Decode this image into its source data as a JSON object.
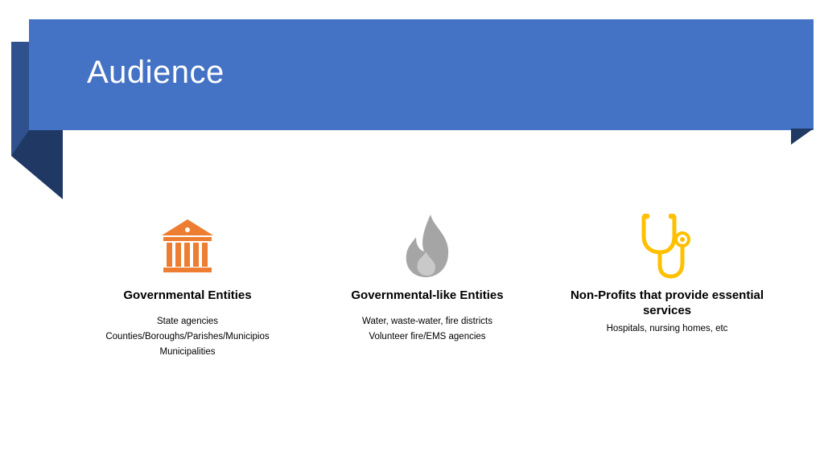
{
  "slide": {
    "title": "Audience"
  },
  "colors": {
    "banner": "#4472c4",
    "fold": "#2f528f",
    "government_icon": "#ed7d31",
    "flame_icon": "#a5a5a5",
    "stethoscope_icon": "#ffc000"
  },
  "columns": [
    {
      "icon": "government-building-icon",
      "heading": "Governmental Entities",
      "lines": [
        "State agencies",
        "Counties/Boroughs/Parishes/Municipios",
        "Municipalities"
      ]
    },
    {
      "icon": "flame-icon",
      "heading": "Governmental-like Entities",
      "lines": [
        "Water, waste-water, fire districts",
        "Volunteer fire/EMS agencies"
      ]
    },
    {
      "icon": "stethoscope-icon",
      "heading": "Non-Profits that provide essential services",
      "lines": [
        "Hospitals, nursing homes, etc"
      ]
    }
  ]
}
